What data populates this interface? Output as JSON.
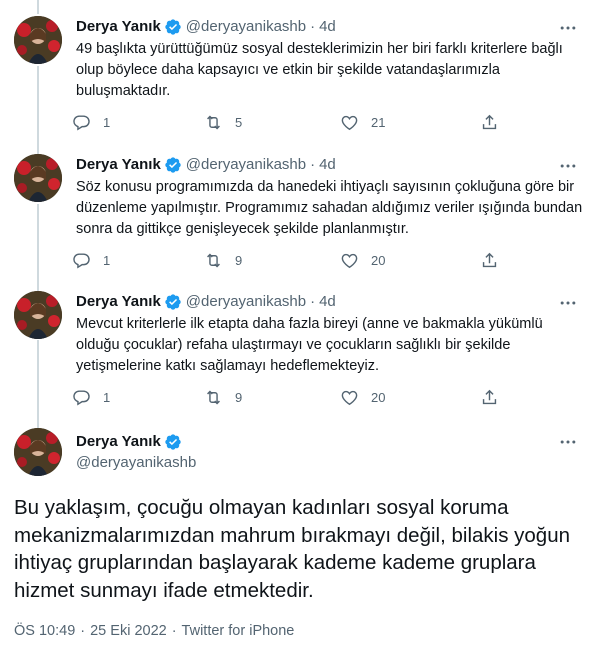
{
  "tweets": [
    {
      "name": "Derya Yanık",
      "handle": "@deryayanikashb",
      "dot": "·",
      "time": "4d",
      "text": "49 başlıkta yürüttüğümüz sosyal desteklerimizin her biri farklı kriterlere bağlı olup böylece daha kapsayıcı ve etkin bir şekilde vatandaşlarımızla buluşmaktadır.",
      "replies": "1",
      "retweets": "5",
      "likes": "21"
    },
    {
      "name": "Derya Yanık",
      "handle": "@deryayanikashb",
      "dot": "·",
      "time": "4d",
      "text": "Söz konusu programımızda da hanedeki ihtiyaçlı sayısının çokluğuna göre bir düzenleme yapılmıştır. Programımız sahadan aldığımız veriler ışığında bundan sonra da gittikçe genişleyecek şekilde planlanmıştır.",
      "replies": "1",
      "retweets": "9",
      "likes": "20"
    },
    {
      "name": "Derya Yanık",
      "handle": "@deryayanikashb",
      "dot": "·",
      "time": "4d",
      "text": "Mevcut kriterlerle ilk etapta daha fazla bireyi (anne ve bakmakla yükümlü olduğu çocuklar) refaha ulaştırmayı ve çocukların sağlıklı bir şekilde yetişmelerine katkı sağlamayı hedeflemekteyiz.",
      "replies": "1",
      "retweets": "9",
      "likes": "20"
    }
  ],
  "main_tweet": {
    "name": "Derya Yanık",
    "handle": "@deryayanikashb",
    "text": "Bu yaklaşım, çocuğu olmayan kadınları sosyal koruma mekanizmalarımızdan mahrum bırakmayı değil, bilakis yoğun ihtiyaç gruplarından başlayarak kademe kademe gruplara hizmet sunmayı ifade etmektedir.",
    "time": "ÖS 10:49",
    "sep1": "·",
    "date": "25 Eki 2022",
    "sep2": "·",
    "source": "Twitter for iPhone"
  },
  "colors": {
    "verified": "#1d9bf0",
    "secondary_text": "#536471",
    "thread_line": "#cfd9de"
  },
  "icons": [
    "verified-badge-icon",
    "more-icon",
    "reply-icon",
    "retweet-icon",
    "like-icon",
    "share-icon"
  ]
}
